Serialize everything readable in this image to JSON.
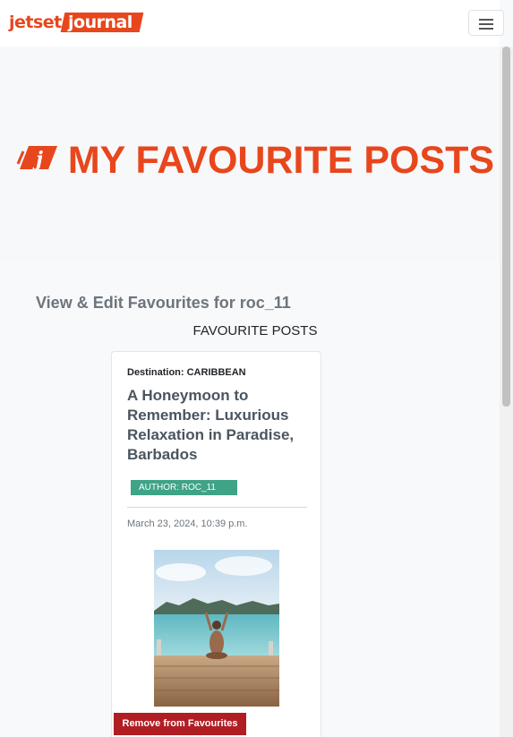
{
  "nav": {
    "logo_part1": "jetset",
    "logo_part2": "journal",
    "menu_icon": "hamburger-menu-icon"
  },
  "hero": {
    "title": "MY FAVOURITE POSTS",
    "icon": "jetset-journal-logo-mark-icon"
  },
  "page": {
    "subheading": "View & Edit Favourites for roc_11",
    "section_label": "FAVOURITE POSTS"
  },
  "posts": [
    {
      "destination": "Destination: CARIBBEAN",
      "title": "A Honeymoon to Remember: Luxurious Relaxation in Paradise, Barbados",
      "author_badge": "AUTHOR: ROC_11",
      "date": "March 23, 2024, 10:39 p.m.",
      "remove_label": "Remove from Favourites"
    }
  ],
  "colors": {
    "brand": "#e8461c",
    "author_badge": "#3fa387",
    "remove_button": "#b01e23"
  }
}
